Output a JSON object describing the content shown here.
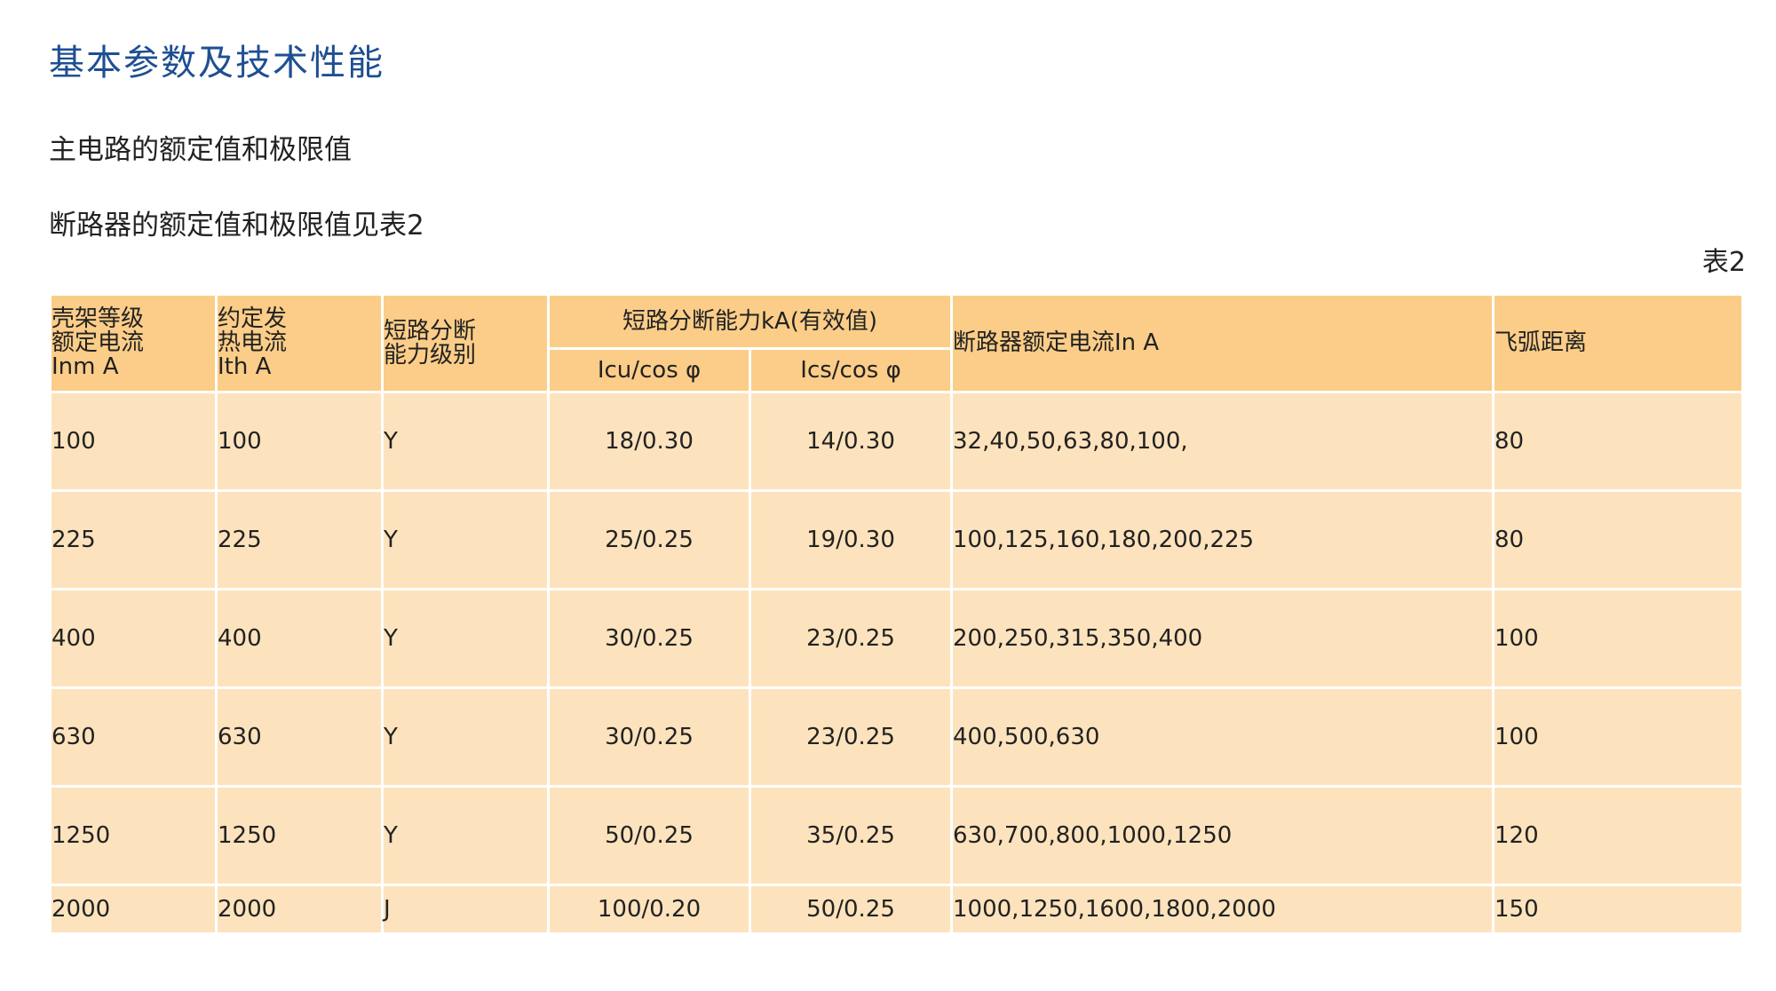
{
  "page": {
    "title": "基本参数及技术性能",
    "section_heading": "主电路的额定值和极限值",
    "section_note": "断路器的额定值和极限值见表2",
    "table_label": "表2"
  },
  "table": {
    "headers": {
      "frame_rating": [
        "壳架等级",
        "额定电流",
        "Inm  A"
      ],
      "thermal_current": [
        "约定发",
        "热电流",
        "Ith  A"
      ],
      "breaking_class": [
        "短路分断",
        "能力级别"
      ],
      "breaking_capacity": "短路分断能力kA(有效值)",
      "icu": "Icu/cos φ",
      "ics": "Ics/cos φ",
      "rated_current": "断路器额定电流In  A",
      "arc_distance": "飞弧距离"
    },
    "rows": [
      {
        "inm": "100",
        "ith": "100",
        "class": "Y",
        "icu": "18/0.30",
        "ics": "14/0.30",
        "in": "32,40,50,63,80,100,",
        "arc": "80"
      },
      {
        "inm": "225",
        "ith": "225",
        "class": "Y",
        "icu": "25/0.25",
        "ics": "19/0.30",
        "in": "100,125,160,180,200,225",
        "arc": "80"
      },
      {
        "inm": "400",
        "ith": "400",
        "class": "Y",
        "icu": "30/0.25",
        "ics": "23/0.25",
        "in": "200,250,315,350,400",
        "arc": "100"
      },
      {
        "inm": "630",
        "ith": "630",
        "class": "Y",
        "icu": "30/0.25",
        "ics": "23/0.25",
        "in": "400,500,630",
        "arc": "100"
      },
      {
        "inm": "1250",
        "ith": "1250",
        "class": "Y",
        "icu": "50/0.25",
        "ics": "35/0.25",
        "in": "630,700,800,1000,1250",
        "arc": "120"
      },
      {
        "inm": "2000",
        "ith": "2000",
        "class": "J",
        "icu": "100/0.20",
        "ics": "50/0.25",
        "in": "1000,1250,1600,1800,2000",
        "arc": "150"
      }
    ]
  },
  "colors": {
    "title": "#1e4f92",
    "header_bg": "#fbcd88",
    "row_bg": "#fde3bd",
    "grid": "#ffffff"
  }
}
